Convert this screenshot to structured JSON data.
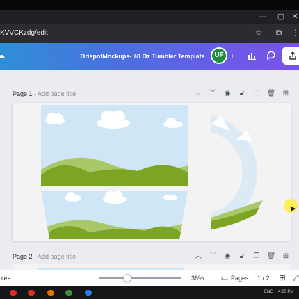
{
  "browser": {
    "url": "KVVCKzdg/edit",
    "bookmark_icon": "star-icon",
    "extensions_icon": "puzzle-icon",
    "minimize_icon": "minimize-icon",
    "more_icon": "more-vert-icon",
    "close_icon": "close-icon"
  },
  "header": {
    "title": "OrispotMockups- 40 Oz Tumbler Template",
    "avatar_initials": "UF",
    "add_icon": "+",
    "analytics_icon": "bar-chart-icon",
    "comment_icon": "comment-icon",
    "share_icon": "share-icon",
    "avatar_color": "#1e8e3e",
    "gradient_start": "#2f8fd6",
    "gradient_end": "#7b52e6"
  },
  "pages": [
    {
      "label": "Page 1",
      "placeholder": "- Add page title"
    },
    {
      "label": "Page 2",
      "placeholder": "- Add page title"
    }
  ],
  "page_tools": [
    "chevron-up-icon",
    "chevron-down-icon",
    "eye-icon",
    "lock-icon",
    "duplicate-icon",
    "delete-icon",
    "add-page-icon"
  ],
  "footer": {
    "notes_label": "otes",
    "zoom_level": "36%",
    "zoom_slider_value": 0.3,
    "pages_label": "Pages",
    "page_counter": "1 / 2",
    "grid_icon": "grid-icon",
    "fullscreen_icon": "fullscreen-icon"
  },
  "taskbar": {
    "lang": "ENG",
    "time": "4:20 PM"
  },
  "colors": {
    "sky": "#cfe6f7",
    "grass_dark": "#7ba523",
    "grass_light": "#aac86a",
    "workspace": "#ebecf0"
  }
}
